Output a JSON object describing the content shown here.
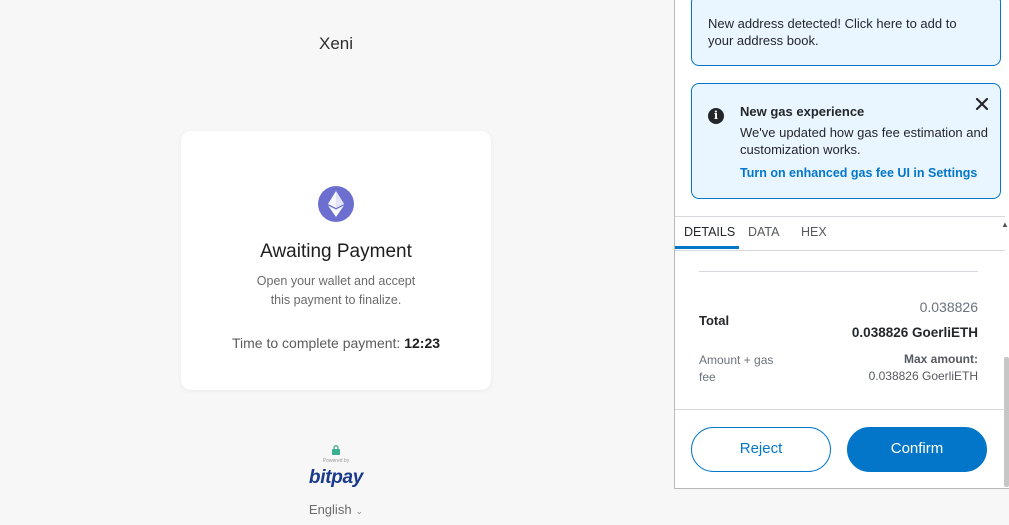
{
  "merchant": {
    "name": "Xeni",
    "card": {
      "title": "Awaiting Payment",
      "subtitle_line1": "Open your wallet and accept",
      "subtitle_line2": "this payment to finalize.",
      "timer_label": "Time to complete payment:",
      "timer_value": "12:23"
    },
    "powered_by": "Powered by",
    "brand": "bitpay",
    "language": "English"
  },
  "popup": {
    "address_banner": "New address detected! Click here to add to your address book.",
    "gas_banner": {
      "title": "New gas experience",
      "body": "We've updated how gas fee estimation and customization works.",
      "link": "Turn on enhanced gas fee UI in Settings"
    },
    "tabs": [
      {
        "label": "DETAILS",
        "active": true
      },
      {
        "label": "DATA",
        "active": false
      },
      {
        "label": "HEX",
        "active": false
      }
    ],
    "total": {
      "fiat": "0.038826",
      "label": "Total",
      "amount": "0.038826 GoerliETH",
      "sub_label": "Amount + gas fee",
      "max_label": "Max amount:",
      "max_value": "0.038826 GoerliETH"
    },
    "buttons": {
      "reject": "Reject",
      "confirm": "Confirm"
    }
  },
  "colors": {
    "accent": "#0376c9",
    "eth": "#6c6fd0",
    "brand": "#1a3b8b"
  }
}
